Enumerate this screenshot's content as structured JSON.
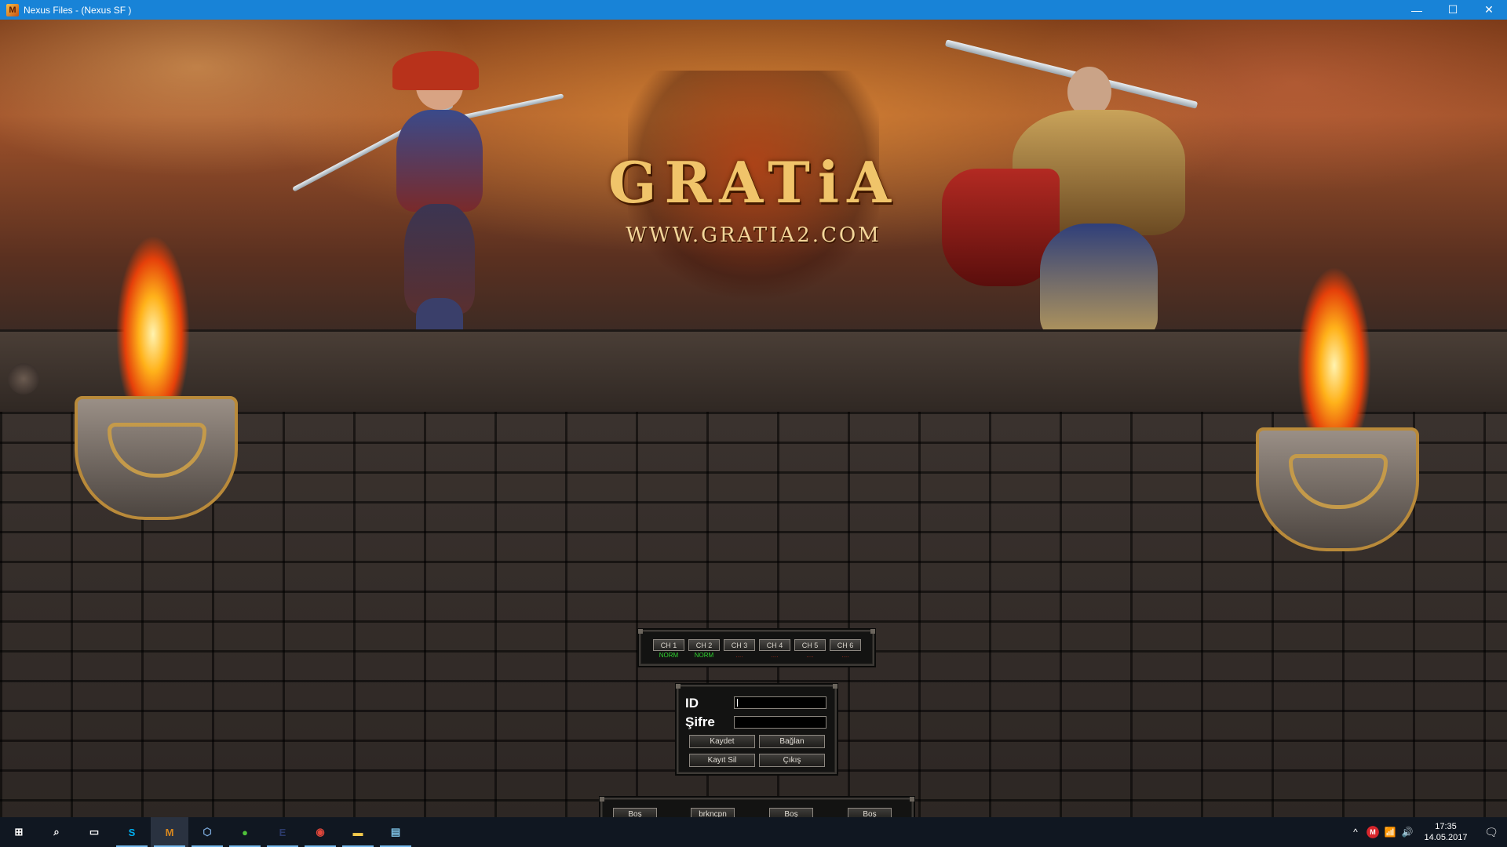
{
  "window": {
    "title": "Nexus Files - (Nexus SF )",
    "controls": [
      "—",
      "☐",
      "✕"
    ]
  },
  "logo": {
    "name": "GRATiA",
    "url": "WWW.GRATIA2.COM"
  },
  "channels": [
    {
      "label": "CH 1",
      "status": "NORM",
      "online": true
    },
    {
      "label": "CH 2",
      "status": "NORM",
      "online": true
    },
    {
      "label": "CH 3",
      "status": "....",
      "online": false
    },
    {
      "label": "CH 4",
      "status": "....",
      "online": false
    },
    {
      "label": "CH 5",
      "status": "....",
      "online": false
    },
    {
      "label": "CH 6",
      "status": "....",
      "online": false
    }
  ],
  "login": {
    "id_label": "ID",
    "id_value": "",
    "password_label": "Şifre",
    "password_value": "",
    "save_label": "Kaydet",
    "connect_label": "Bağlan",
    "delete_label": "Kayıt Sil",
    "exit_label": "Çıkış"
  },
  "slots": [
    "Boş",
    "brkncpn",
    "Boş",
    "Boş"
  ],
  "taskbar": {
    "apps": [
      {
        "name": "start-icon",
        "glyph": "⊞",
        "color": "#ffffff",
        "running": false
      },
      {
        "name": "search-icon",
        "glyph": "⌕",
        "color": "#ffffff",
        "running": false
      },
      {
        "name": "task-view-icon",
        "glyph": "▭",
        "color": "#ffffff",
        "running": false
      },
      {
        "name": "skype-icon",
        "glyph": "S",
        "color": "#00aff0",
        "running": true
      },
      {
        "name": "game-client-icon",
        "glyph": "M",
        "color": "#d9881e",
        "running": true
      },
      {
        "name": "virtualbox-icon",
        "glyph": "⬡",
        "color": "#7aa7d8",
        "running": true
      },
      {
        "name": "green-app-icon",
        "glyph": "●",
        "color": "#4fc23a",
        "running": true
      },
      {
        "name": "epack-icon",
        "glyph": "E",
        "color": "#2b3a6a",
        "running": true
      },
      {
        "name": "chrome-icon",
        "glyph": "◉",
        "color": "#e2473b",
        "running": true
      },
      {
        "name": "file-explorer-icon",
        "glyph": "▬",
        "color": "#f2c94c",
        "running": true
      },
      {
        "name": "notepad-icon",
        "glyph": "▤",
        "color": "#7fc4e8",
        "running": true
      }
    ],
    "tray_icons": [
      {
        "name": "show-hidden-icons-icon",
        "glyph": "^"
      },
      {
        "name": "antivirus-icon",
        "glyph": "M"
      },
      {
        "name": "wifi-icon",
        "glyph": "📶"
      },
      {
        "name": "volume-icon",
        "glyph": "🔊"
      }
    ],
    "time": "17:35",
    "date": "14.05.2017",
    "notification_glyph": "🗨"
  }
}
